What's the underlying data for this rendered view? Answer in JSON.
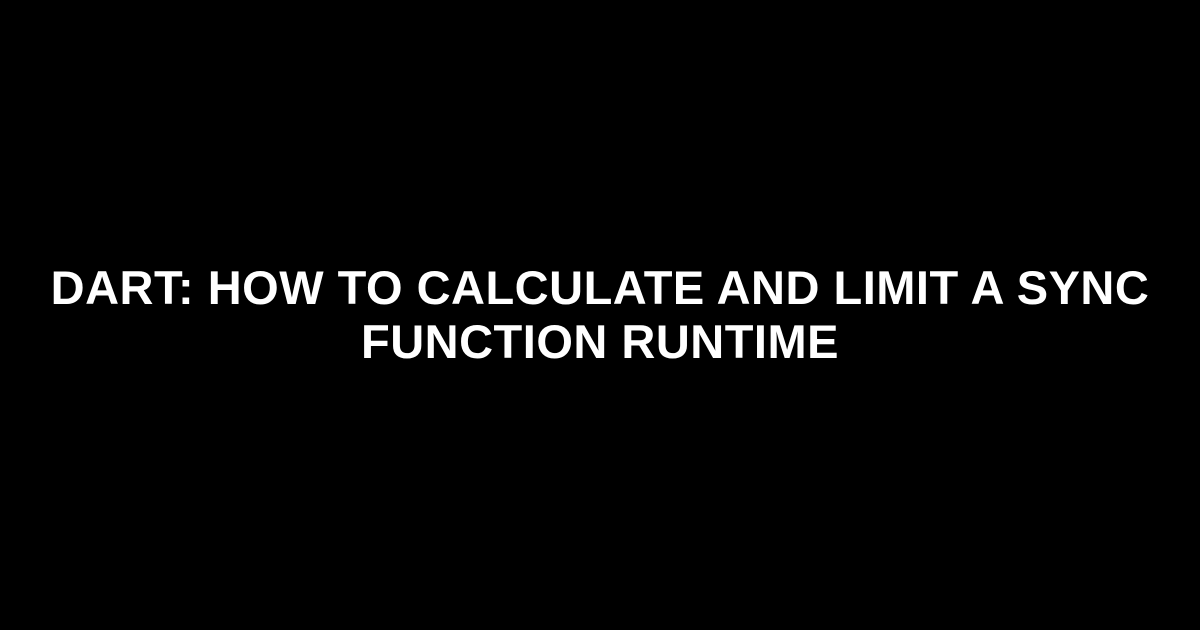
{
  "main": {
    "title": "Dart: How to Calculate and Limit a Sync Function Runtime"
  }
}
